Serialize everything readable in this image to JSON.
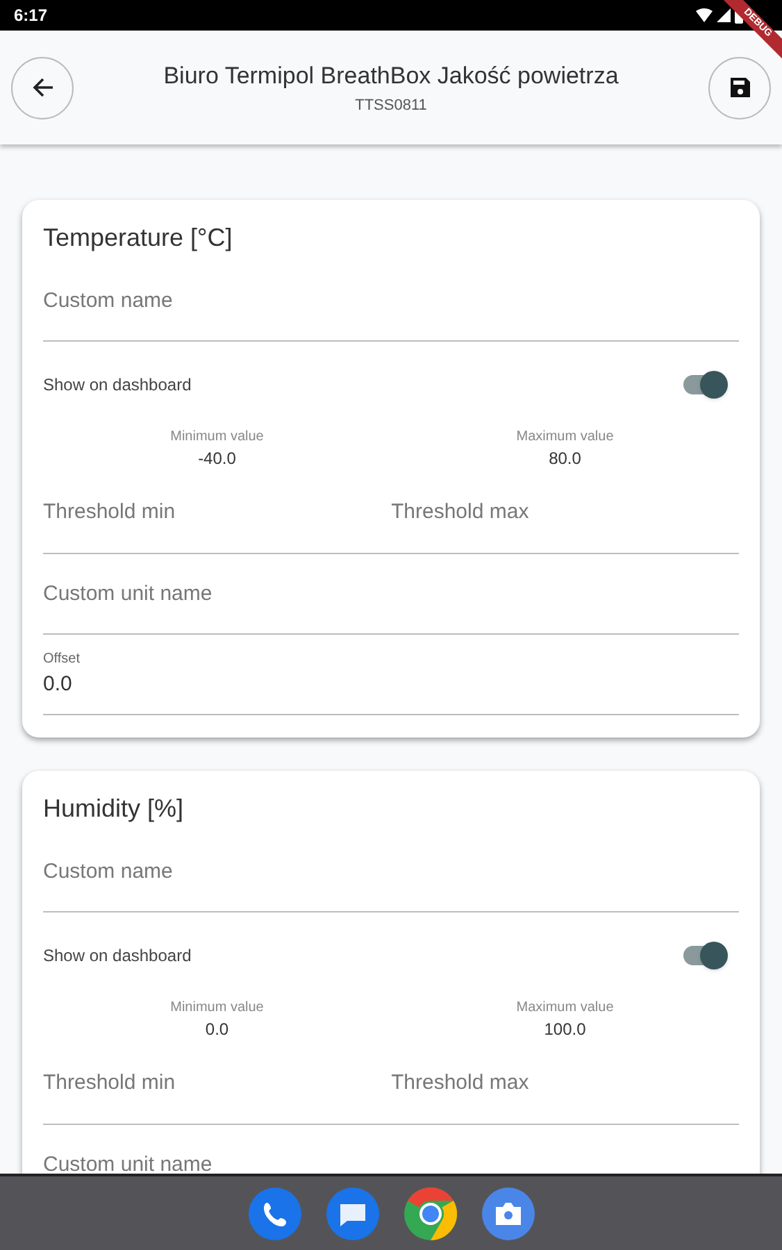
{
  "status_bar": {
    "time": "6:17"
  },
  "debug_banner": "DEBUG",
  "app_bar": {
    "title": "Biuro Termipol BreathBox Jakość powietrza",
    "subtitle": "TTSS0811"
  },
  "sensors": [
    {
      "title": "Temperature [°C]",
      "custom_name": {
        "placeholder": "Custom name"
      },
      "show_on_dashboard": {
        "label": "Show on dashboard",
        "on": true
      },
      "minimum": {
        "label": "Minimum value",
        "value": "-40.0"
      },
      "maximum": {
        "label": "Maximum value",
        "value": "80.0"
      },
      "threshold_min": {
        "placeholder": "Threshold min"
      },
      "threshold_max": {
        "placeholder": "Threshold max"
      },
      "custom_unit_name": {
        "placeholder": "Custom unit name"
      },
      "offset": {
        "label": "Offset",
        "value": "0.0"
      }
    },
    {
      "title": "Humidity [%]",
      "custom_name": {
        "placeholder": "Custom name"
      },
      "show_on_dashboard": {
        "label": "Show on dashboard",
        "on": true
      },
      "minimum": {
        "label": "Minimum value",
        "value": "0.0"
      },
      "maximum": {
        "label": "Maximum value",
        "value": "100.0"
      },
      "threshold_min": {
        "placeholder": "Threshold min"
      },
      "threshold_max": {
        "placeholder": "Threshold max"
      },
      "custom_unit_name": {
        "placeholder": "Custom unit name"
      }
    }
  ]
}
